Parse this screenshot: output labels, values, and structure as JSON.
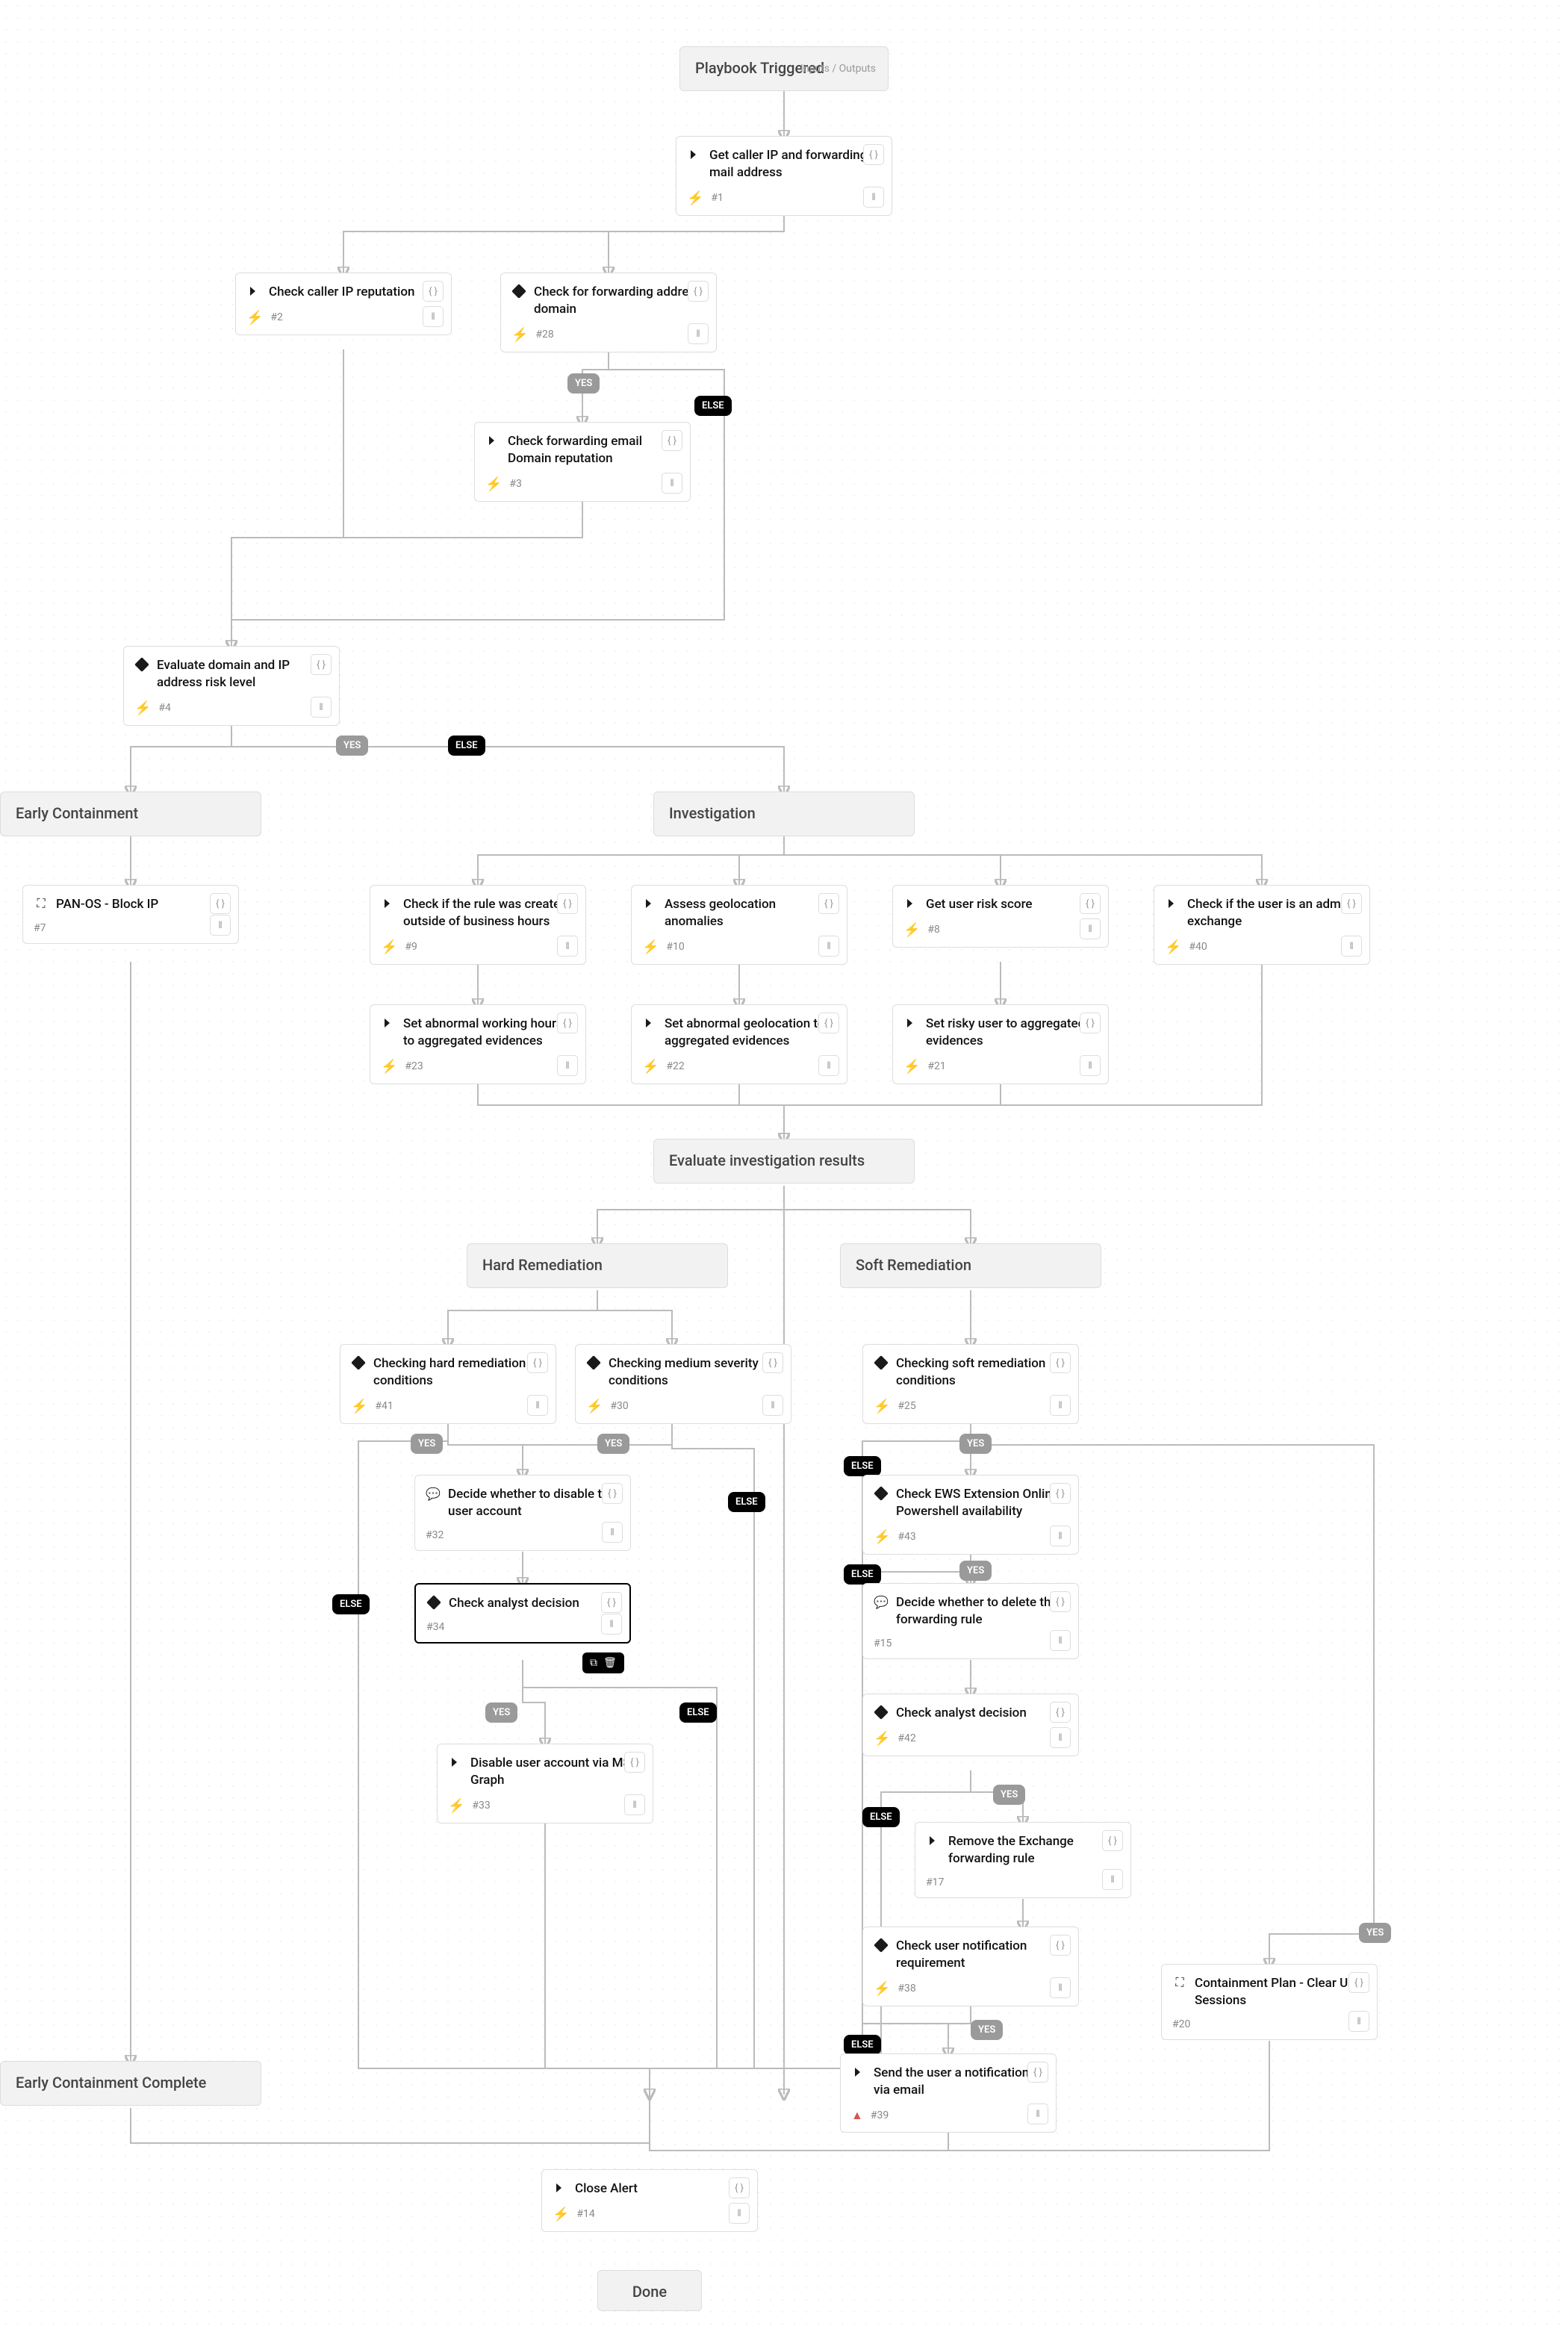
{
  "chart_data": {
    "type": "flowchart",
    "title": "Playbook Triggered",
    "inputs_outputs_label": "Inputs / Outputs",
    "done_label": "Done",
    "sections": [
      {
        "id": "playbook_triggered",
        "label": "Playbook Triggered",
        "parent": null
      },
      {
        "id": "early_containment",
        "label": "Early Containment",
        "parent": "n4",
        "branch": "YES"
      },
      {
        "id": "investigation",
        "label": "Investigation",
        "parent": "n4",
        "branch": "ELSE"
      },
      {
        "id": "evaluate_investigation",
        "label": "Evaluate investigation results",
        "parent": "investigation"
      },
      {
        "id": "hard_remediation",
        "label": "Hard Remediation",
        "parent": "evaluate_investigation"
      },
      {
        "id": "soft_remediation",
        "label": "Soft Remediation",
        "parent": "evaluate_investigation"
      },
      {
        "id": "early_containment_complete",
        "label": "Early Containment Complete",
        "parent": "early_containment"
      },
      {
        "id": "done",
        "label": "Done",
        "parent": "n14"
      }
    ],
    "nodes": [
      {
        "id": "n1",
        "num": "#1",
        "label": "Get caller IP and forwarding mail address",
        "type": "script",
        "icon": "chevron",
        "bolt": true,
        "parent": "playbook_triggered"
      },
      {
        "id": "n2",
        "num": "#2",
        "label": "Check caller IP reputation",
        "type": "script",
        "icon": "chevron",
        "bolt": true,
        "parent": "n1"
      },
      {
        "id": "n28",
        "num": "#28",
        "label": "Check for forwarding address domain",
        "type": "condition",
        "icon": "diamond",
        "bolt": true,
        "parent": "n1"
      },
      {
        "id": "n3",
        "num": "#3",
        "label": "Check forwarding email Domain reputation",
        "type": "script",
        "icon": "chevron",
        "bolt": true,
        "parent": "n28",
        "branch": "YES"
      },
      {
        "id": "n4",
        "num": "#4",
        "label": "Evaluate domain and IP address risk level",
        "type": "condition",
        "icon": "diamond",
        "bolt": true,
        "parents": [
          "n2",
          "n3",
          "n28:ELSE"
        ]
      },
      {
        "id": "n7",
        "num": "#7",
        "label": "PAN-OS - Block IP",
        "type": "subplaybook",
        "icon": "tree",
        "bolt": false,
        "parent": "early_containment"
      },
      {
        "id": "n9",
        "num": "#9",
        "label": "Check if the rule was created outside of business hours",
        "type": "script",
        "icon": "chevron",
        "bolt": true,
        "parent": "investigation"
      },
      {
        "id": "n10",
        "num": "#10",
        "label": "Assess geolocation anomalies",
        "type": "script",
        "icon": "chevron",
        "bolt": true,
        "parent": "investigation"
      },
      {
        "id": "n8",
        "num": "#8",
        "label": "Get user risk score",
        "type": "script",
        "icon": "chevron",
        "bolt": true,
        "parent": "investigation"
      },
      {
        "id": "n40",
        "num": "#40",
        "label": "Check if the user is an admin exchange",
        "type": "script",
        "icon": "chevron",
        "bolt": true,
        "parent": "investigation"
      },
      {
        "id": "n23",
        "num": "#23",
        "label": "Set abnormal working hours to aggregated evidences",
        "type": "script",
        "icon": "chevron",
        "bolt": true,
        "parent": "n9"
      },
      {
        "id": "n22",
        "num": "#22",
        "label": "Set abnormal geolocation to aggregated evidences",
        "type": "script",
        "icon": "chevron",
        "bolt": true,
        "parent": "n10"
      },
      {
        "id": "n21",
        "num": "#21",
        "label": "Set risky user to aggregated evidences",
        "type": "script",
        "icon": "chevron",
        "bolt": true,
        "parent": "n8"
      },
      {
        "id": "n41",
        "num": "#41",
        "label": "Checking hard remediation conditions",
        "type": "condition",
        "icon": "diamond",
        "bolt": true,
        "parent": "hard_remediation"
      },
      {
        "id": "n30",
        "num": "#30",
        "label": "Checking medium severity conditions",
        "type": "condition",
        "icon": "diamond",
        "bolt": true,
        "parent": "hard_remediation"
      },
      {
        "id": "n32",
        "num": "#32",
        "label": "Decide whether to disable the user account",
        "type": "manual",
        "icon": "chat",
        "bolt": false,
        "parents": [
          "n41:YES",
          "n30:YES"
        ]
      },
      {
        "id": "n34",
        "num": "#34",
        "label": "Check analyst decision",
        "type": "condition",
        "icon": "diamond",
        "bolt": false,
        "parent": "n32"
      },
      {
        "id": "n33",
        "num": "#33",
        "label": "Disable user account via MS-Graph",
        "type": "script",
        "icon": "chevron",
        "bolt": true,
        "parent": "n34",
        "branch": "YES"
      },
      {
        "id": "n25",
        "num": "#25",
        "label": "Checking soft remediation conditions",
        "type": "condition",
        "icon": "diamond",
        "bolt": true,
        "parent": "soft_remediation"
      },
      {
        "id": "n43",
        "num": "#43",
        "label": "Check EWS Extension Online Powershell availability",
        "type": "condition",
        "icon": "diamond",
        "bolt": true,
        "parent": "n25",
        "branch": "YES"
      },
      {
        "id": "n15",
        "num": "#15",
        "label": "Decide whether to delete the forwarding rule",
        "type": "manual",
        "icon": "chat",
        "bolt": false,
        "parent": "n43",
        "branch": "YES"
      },
      {
        "id": "n42",
        "num": "#42",
        "label": "Check analyst decision",
        "type": "condition",
        "icon": "diamond",
        "bolt": true,
        "parent": "n15"
      },
      {
        "id": "n17",
        "num": "#17",
        "label": "Remove the Exchange forwarding rule",
        "type": "script",
        "icon": "chevron",
        "bolt": true,
        "parent": "n42",
        "branch": "YES"
      },
      {
        "id": "n38",
        "num": "#38",
        "label": "Check user notification requirement",
        "type": "condition",
        "icon": "diamond",
        "bolt": true,
        "parent": "n17"
      },
      {
        "id": "n39",
        "num": "#39",
        "label": "Send the user a notification via email",
        "type": "script",
        "icon": "chevron",
        "warn": true,
        "parent": "n38",
        "branch": "YES"
      },
      {
        "id": "n20",
        "num": "#20",
        "label": "Containment Plan - Clear User Sessions",
        "type": "subplaybook",
        "icon": "tree",
        "bolt": false,
        "parent": "n25",
        "branch": "YES"
      },
      {
        "id": "n14",
        "num": "#14",
        "label": "Close Alert",
        "type": "script",
        "icon": "chevron",
        "bolt": true,
        "parents": [
          "early_containment_complete",
          "n39",
          "n33",
          "n34:ELSE",
          "n30:ELSE",
          "n25:ELSE",
          "n43:ELSE",
          "n42:ELSE",
          "n38:ELSE",
          "n20"
        ]
      }
    ],
    "branch_labels": {
      "yes": "YES",
      "else": "ELSE"
    }
  }
}
